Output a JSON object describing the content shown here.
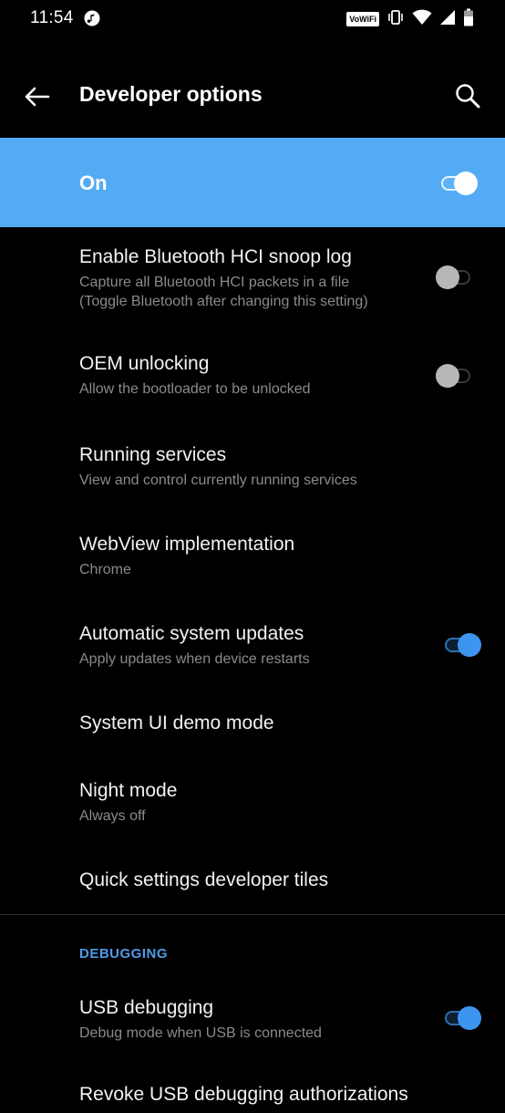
{
  "status_bar": {
    "time": "11:54",
    "vowifi_label": "VoWiFi"
  },
  "app_bar": {
    "title": "Developer options"
  },
  "master_switch": {
    "label": "On",
    "state": "on"
  },
  "settings": [
    {
      "title": "Enable Bluetooth HCI snoop log",
      "summary_line1": "Capture all Bluetooth HCI packets in a file",
      "summary_line2": "(Toggle Bluetooth after changing this setting)",
      "toggle": "off"
    },
    {
      "title": "OEM unlocking",
      "summary_line1": "Allow the bootloader to be unlocked",
      "toggle": "off"
    },
    {
      "title": "Running services",
      "summary_line1": "View and control currently running services"
    },
    {
      "title": "WebView implementation",
      "summary_line1": "Chrome"
    },
    {
      "title": "Automatic system updates",
      "summary_line1": "Apply updates when device restarts",
      "toggle": "on"
    },
    {
      "title": "System UI demo mode"
    },
    {
      "title": "Night mode",
      "summary_line1": "Always off"
    },
    {
      "title": "Quick settings developer tiles"
    }
  ],
  "debugging": {
    "header": "DEBUGGING",
    "usb_debugging": {
      "title": "USB debugging",
      "summary": "Debug mode when USB is connected",
      "toggle": "on"
    },
    "revoke_partial": "Revoke USB debugging authorizations"
  },
  "colors": {
    "background": "#000000",
    "accent": "#52abf3",
    "toggle_on": "#3d95f0",
    "section_header": "#4f9be8"
  }
}
